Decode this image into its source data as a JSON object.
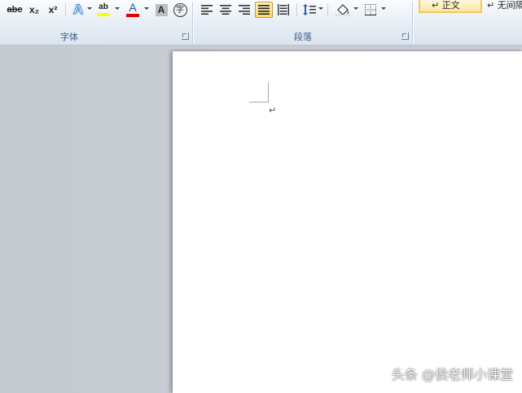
{
  "ribbon": {
    "font_group": {
      "label": "字体",
      "buttons": [
        {
          "name": "strikethrough",
          "glyph": "abc"
        },
        {
          "name": "subscript",
          "glyph": "x₂"
        },
        {
          "name": "superscript",
          "glyph": "x²"
        },
        {
          "name": "text-effects",
          "glyph": "A"
        },
        {
          "name": "highlight",
          "glyph": "ab"
        },
        {
          "name": "font-color",
          "glyph": "A"
        },
        {
          "name": "char-shading",
          "glyph": "A"
        },
        {
          "name": "enclose-char",
          "glyph": "字"
        }
      ]
    },
    "paragraph_group": {
      "label": "段落"
    },
    "styles": {
      "normal": "↵ 正文",
      "no_spacing": "↵ 无间隔"
    }
  },
  "document": {
    "paragraph_mark": "↵"
  },
  "watermark": "头条 @侯老师小课堂",
  "colors": {
    "highlight_yellow": "#ffff00",
    "font_red": "#e00000",
    "active_button": "#ffd66b"
  }
}
